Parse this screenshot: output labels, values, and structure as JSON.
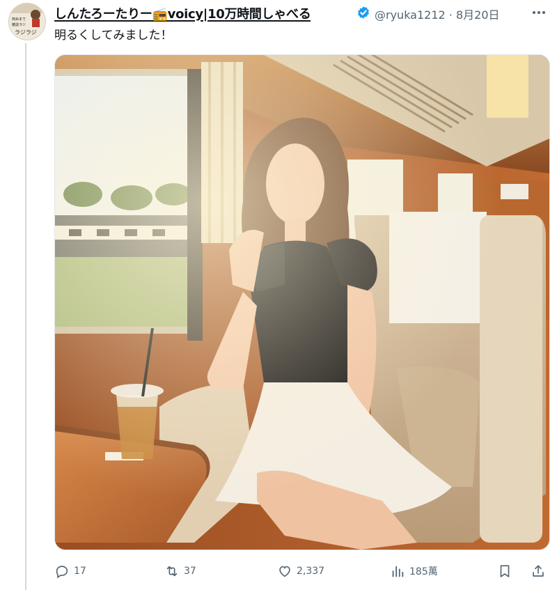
{
  "tweet": {
    "display_name": "しんたろーたりー📻voicy|10万時間しゃべる",
    "handle": "@ryuka1212",
    "separator": "·",
    "date": "8月20日",
    "text": "明るくしてみました！",
    "avatar_text": [
      "死ぬまで",
      "雑談ラジ",
      "ラジラジ"
    ],
    "verified_color": "#1d9bf0"
  },
  "actions": {
    "reply_count": "17",
    "retweet_count": "37",
    "like_count": "2,337",
    "views_count": "185萬"
  },
  "icons": {
    "more": "more-horizontal-icon",
    "verified": "verified-badge-icon",
    "reply": "reply-icon",
    "retweet": "retweet-icon",
    "like": "heart-icon",
    "views": "analytics-icon",
    "bookmark": "bookmark-icon",
    "share": "share-icon"
  }
}
